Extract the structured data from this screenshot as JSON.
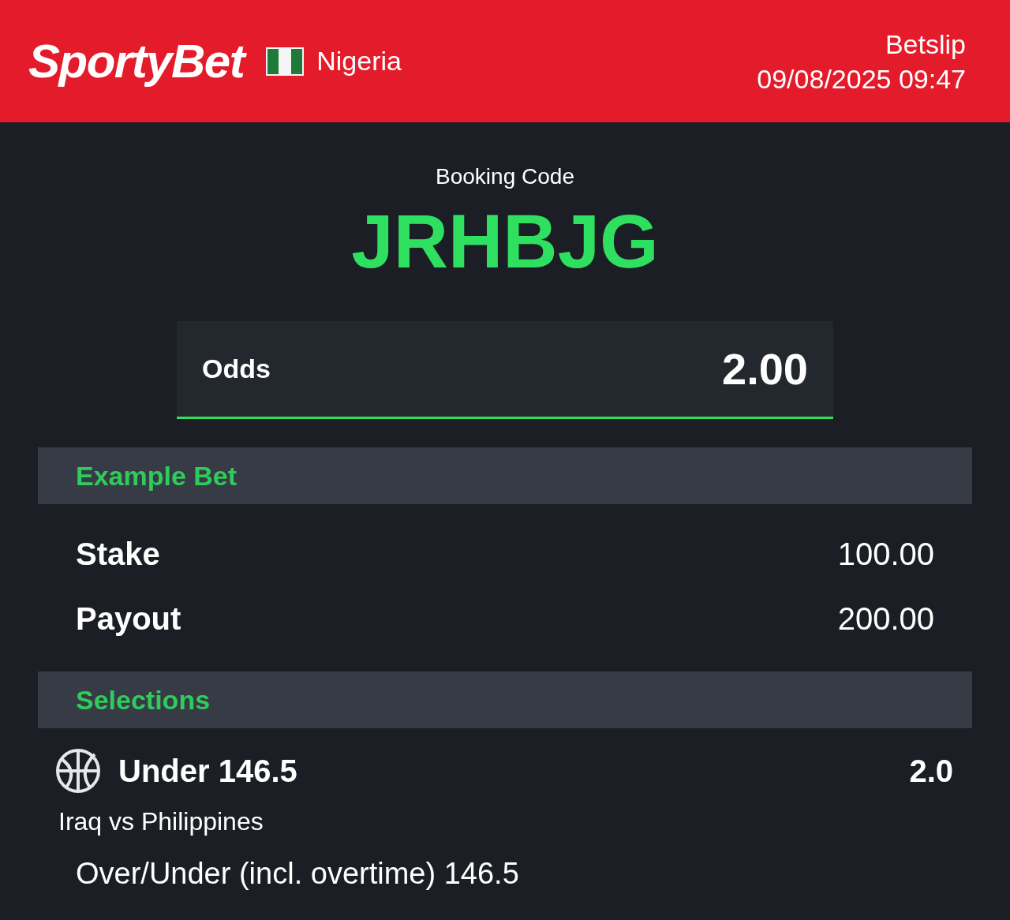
{
  "header": {
    "logo": "SportyBet",
    "country": "Nigeria",
    "title": "Betslip",
    "datetime": "09/08/2025 09:47"
  },
  "booking": {
    "label": "Booking Code",
    "code": "JRHBJG"
  },
  "odds": {
    "label": "Odds",
    "value": "2.00"
  },
  "example_bet": {
    "title": "Example Bet",
    "rows": [
      {
        "label": "Stake",
        "value": "100.00"
      },
      {
        "label": "Payout",
        "value": "200.00"
      }
    ]
  },
  "selections": {
    "title": "Selections",
    "items": [
      {
        "pick": "Under 146.5",
        "odds": "2.0",
        "match": "Iraq vs Philippines",
        "market": "Over/Under (incl. overtime) 146.5"
      }
    ]
  }
}
